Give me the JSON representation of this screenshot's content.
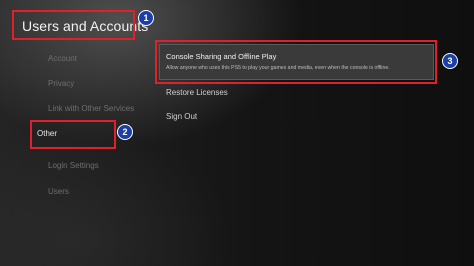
{
  "header": {
    "title": "Users and Accounts"
  },
  "sidebar": {
    "items": [
      {
        "label": "Account"
      },
      {
        "label": "Privacy"
      },
      {
        "label": "Link with Other Services"
      },
      {
        "label": "Other"
      },
      {
        "label": "Login Settings"
      },
      {
        "label": "Users"
      }
    ],
    "selected": "Other"
  },
  "main": {
    "options": [
      {
        "label": "Console Sharing and Offline Play",
        "description": "Allow anyone who uses this PS5 to play your games and media, even when the console is offline."
      },
      {
        "label": "Restore Licenses"
      },
      {
        "label": "Sign Out"
      }
    ]
  },
  "annotations": {
    "badges": [
      "1",
      "2",
      "3"
    ],
    "highlight_color": "#e0202a",
    "badge_color": "#1a3fa8"
  }
}
